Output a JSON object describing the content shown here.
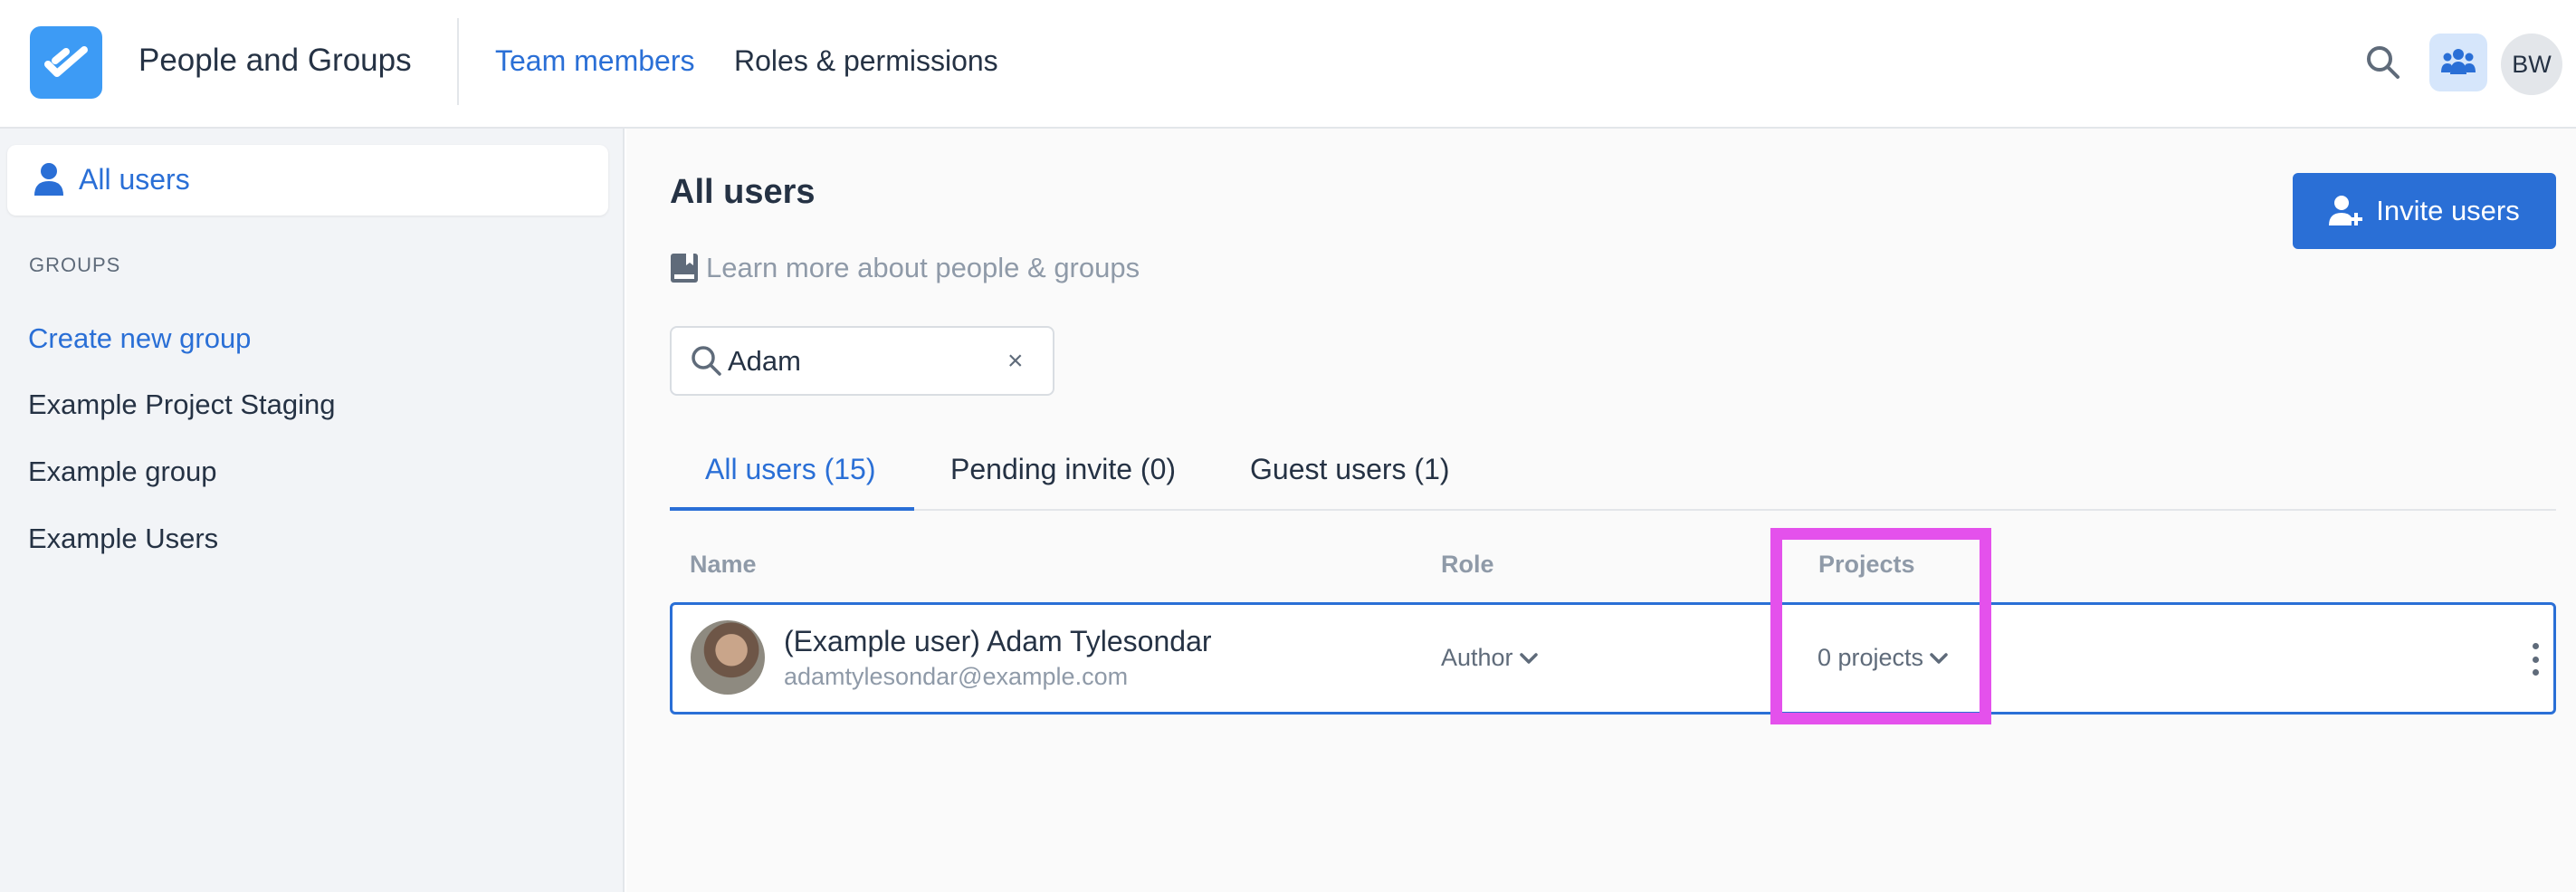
{
  "header": {
    "app_title": "People and Groups",
    "nav_tabs": [
      {
        "label": "Team members",
        "active": true
      },
      {
        "label": "Roles & permissions",
        "active": false
      }
    ],
    "user_initials": "BW"
  },
  "sidebar": {
    "active_item": "All users",
    "groups_heading": "GROUPS",
    "create_group_label": "Create new group",
    "groups": [
      "Example Project Staging",
      "Example group",
      "Example Users"
    ]
  },
  "main": {
    "title": "All users",
    "learn_more": "Learn more about people & groups",
    "invite_label": "Invite users",
    "search": {
      "value": "Adam",
      "clear": "×"
    },
    "tabs": [
      {
        "label": "All users (15)",
        "active": true
      },
      {
        "label": "Pending invite (0)",
        "active": false
      },
      {
        "label": "Guest users (1)",
        "active": false
      }
    ],
    "columns": [
      "Name",
      "Role",
      "Projects"
    ],
    "rows": [
      {
        "name": "(Example user) Adam Tylesondar",
        "email": "adamtylesondar@example.com",
        "role": "Author",
        "projects": "0 projects"
      }
    ]
  },
  "colors": {
    "accent": "#2a6fd6",
    "logo": "#3d9bf5",
    "highlight": "#e451ec",
    "sidebar_bg": "#f2f4f7"
  }
}
